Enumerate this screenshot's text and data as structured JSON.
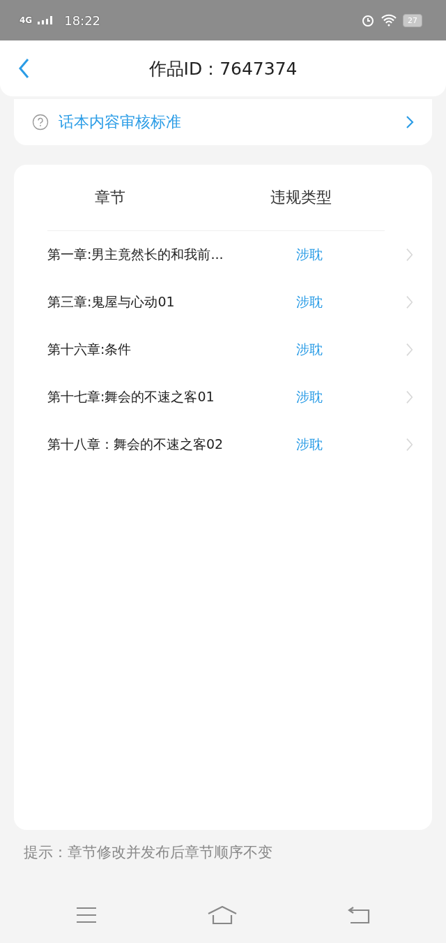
{
  "status_bar": {
    "network": "4G",
    "time": "18:22",
    "battery": "27"
  },
  "header": {
    "title": "作品ID：7647374"
  },
  "guideline_link": {
    "label": "话本内容审核标准"
  },
  "table": {
    "columns": [
      "章节",
      "违规类型"
    ],
    "rows": [
      {
        "chapter": "第一章:男主竟然长的和我前...",
        "violation": "涉耽"
      },
      {
        "chapter": "第三章:鬼屋与心动01",
        "violation": "涉耽"
      },
      {
        "chapter": "第十六章:条件",
        "violation": "涉耽"
      },
      {
        "chapter": "第十七章:舞会的不速之客01",
        "violation": "涉耽"
      },
      {
        "chapter": "第十八章：舞会的不速之客02",
        "violation": "涉耽"
      }
    ]
  },
  "tip": "提示：章节修改并发布后章节顺序不变"
}
